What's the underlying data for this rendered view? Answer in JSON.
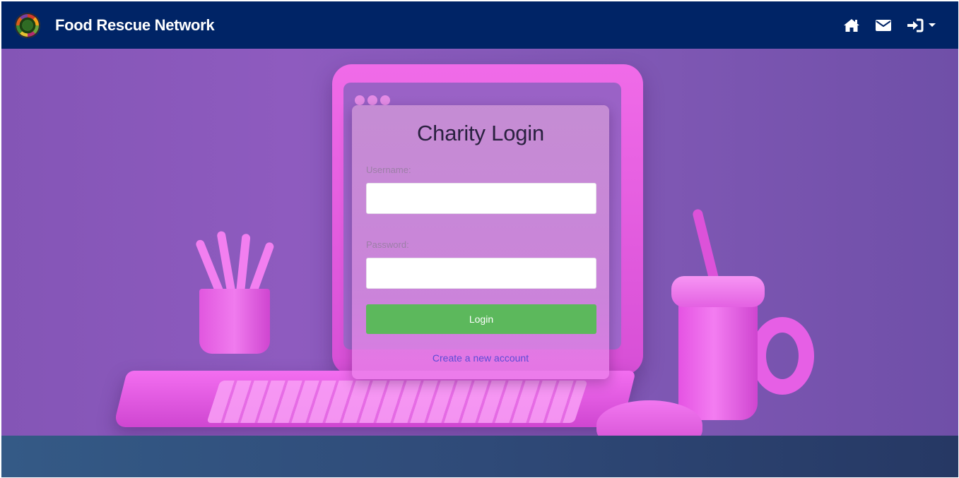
{
  "navbar": {
    "brand_name": "Food Rescue Network",
    "icons": [
      "home-icon",
      "envelope-icon",
      "sign-in-icon"
    ],
    "colors": {
      "background": "#002466",
      "text": "#ffffff"
    }
  },
  "login": {
    "title": "Charity Login",
    "username_label": "Username:",
    "username_value": "",
    "password_label": "Password:",
    "password_value": "",
    "login_button": "Login",
    "create_account_link": "Create a new account",
    "colors": {
      "button": "#5cb85c",
      "link": "#5d4bd6"
    }
  },
  "footer": {
    "colors": {
      "background": "#2f4a78"
    }
  }
}
